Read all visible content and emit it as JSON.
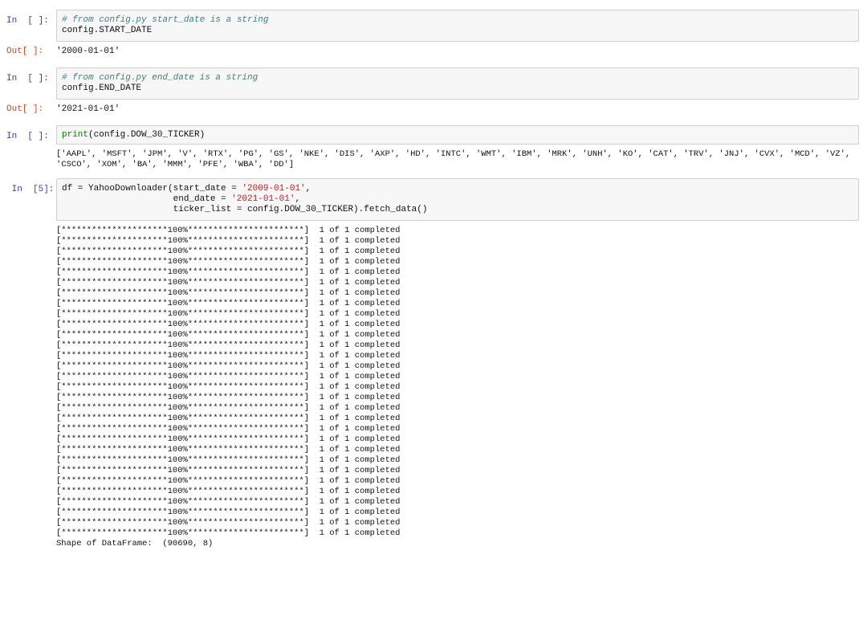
{
  "cells": [
    {
      "type": "code",
      "prompt": "In  [ ]:",
      "lines": [
        {
          "parts": [
            {
              "text": "# from config.py start_date is a string",
              "style": "comment"
            }
          ]
        },
        {
          "parts": [
            {
              "text": "config.START_DATE",
              "style": "plain"
            }
          ]
        }
      ],
      "output": {
        "prompt": "Out[ ]:",
        "text": "'2000-01-01'"
      }
    },
    {
      "type": "code",
      "prompt": "In  [ ]:",
      "lines": [
        {
          "parts": [
            {
              "text": "# from config.py end_date is a string",
              "style": "comment"
            }
          ]
        },
        {
          "parts": [
            {
              "text": "config.END_DATE",
              "style": "plain"
            }
          ]
        }
      ],
      "output": {
        "prompt": "Out[ ]:",
        "text": "'2021-01-01'"
      }
    },
    {
      "type": "code",
      "prompt": "In  [ ]:",
      "lines": [
        {
          "parts": [
            {
              "text": "print",
              "style": "builtin"
            },
            {
              "text": "(config.DOW_30_TICKER)",
              "style": "plain"
            }
          ]
        }
      ],
      "stdout": "['AAPL', 'MSFT', 'JPM', 'V', 'RTX', 'PG', 'GS', 'NKE', 'DIS', 'AXP', 'HD', 'INTC', 'WMT', 'IBM', 'MRK', 'UNH', 'KO', 'CAT', 'TRV', 'JNJ', 'CVX', 'MCD', 'VZ', 'CSCO', 'XOM', 'BA', 'MMM', 'PFE', 'WBA', 'DD']"
    },
    {
      "type": "code",
      "prompt": " In  [5]:",
      "lines": [
        {
          "parts": [
            {
              "text": "df = YahooDownloader(start_date = ",
              "style": "plain"
            },
            {
              "text": "'2009-01-01'",
              "style": "str"
            },
            {
              "text": ",",
              "style": "plain"
            }
          ]
        },
        {
          "parts": [
            {
              "text": "                     end_date = ",
              "style": "plain"
            },
            {
              "text": "'2021-01-01'",
              "style": "str"
            },
            {
              "text": ",",
              "style": "plain"
            }
          ]
        },
        {
          "parts": [
            {
              "text": "                     ticker_list = config.DOW_30_TICKER).fetch_data()",
              "style": "plain"
            }
          ]
        }
      ],
      "progress": {
        "line": "[*********************100%***********************]  1 of 1 completed",
        "count": 30
      },
      "trailing": "Shape of DataFrame:  (90690, 8)"
    }
  ]
}
